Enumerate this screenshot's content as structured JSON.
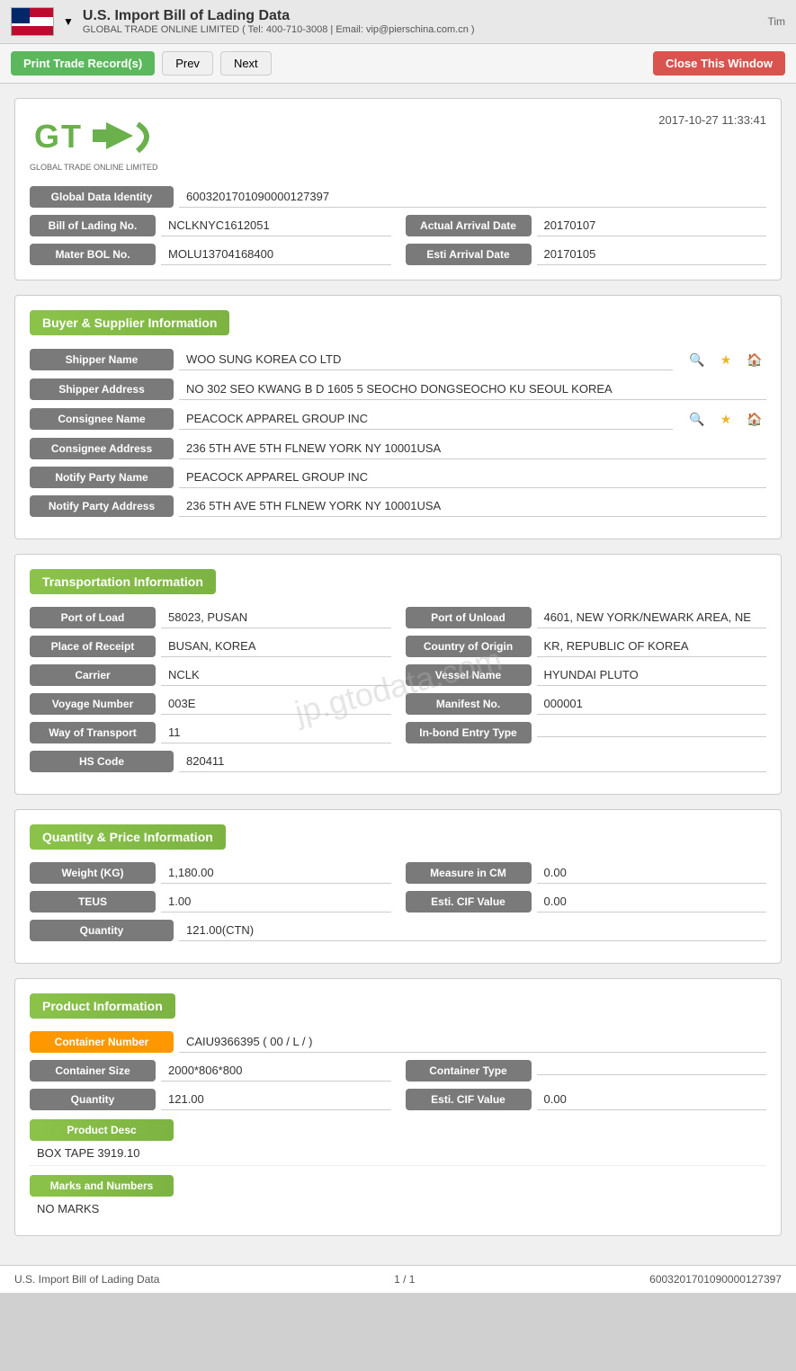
{
  "topbar": {
    "title": "U.S. Import Bill of Lading Data",
    "subtitle": "GLOBAL TRADE ONLINE LIMITED ( Tel: 400-710-3008 | Email: vip@pierschina.com.cn )",
    "right_text": "Tim",
    "dropdown_icon": "▼"
  },
  "toolbar": {
    "print_label": "Print Trade Record(s)",
    "prev_label": "Prev",
    "next_label": "Next",
    "close_label": "Close This Window"
  },
  "header_card": {
    "date": "2017-10-27 11:33:41",
    "logo_sub": "GLOBAL TRADE ONLINE LIMITED",
    "global_data_identity_label": "Global Data Identity",
    "global_data_identity_value": "6003201701090000127397",
    "bill_of_lading_label": "Bill of Lading No.",
    "bill_of_lading_value": "NCLKNYC1612051",
    "actual_arrival_label": "Actual Arrival Date",
    "actual_arrival_value": "20170107",
    "master_bol_label": "Mater BOL No.",
    "master_bol_value": "MOLU13704168400",
    "esti_arrival_label": "Esti Arrival Date",
    "esti_arrival_value": "20170105"
  },
  "buyer_supplier": {
    "section_title": "Buyer & Supplier Information",
    "shipper_name_label": "Shipper Name",
    "shipper_name_value": "WOO SUNG KOREA CO LTD",
    "shipper_address_label": "Shipper Address",
    "shipper_address_value": "NO 302 SEO KWANG B D 1605 5 SEOCHO DONGSEOCHO KU SEOUL KOREA",
    "consignee_name_label": "Consignee Name",
    "consignee_name_value": "PEACOCK APPAREL GROUP INC",
    "consignee_address_label": "Consignee Address",
    "consignee_address_value": "236 5TH AVE 5TH FLNEW YORK NY 10001USA",
    "notify_party_name_label": "Notify Party Name",
    "notify_party_name_value": "PEACOCK APPAREL GROUP INC",
    "notify_party_address_label": "Notify Party Address",
    "notify_party_address_value": "236 5TH AVE 5TH FLNEW YORK NY 10001USA"
  },
  "transportation": {
    "section_title": "Transportation Information",
    "port_of_load_label": "Port of Load",
    "port_of_load_value": "58023, PUSAN",
    "port_of_unload_label": "Port of Unload",
    "port_of_unload_value": "4601, NEW YORK/NEWARK AREA, NE",
    "place_of_receipt_label": "Place of Receipt",
    "place_of_receipt_value": "BUSAN, KOREA",
    "country_of_origin_label": "Country of Origin",
    "country_of_origin_value": "KR, REPUBLIC OF KOREA",
    "carrier_label": "Carrier",
    "carrier_value": "NCLK",
    "vessel_name_label": "Vessel Name",
    "vessel_name_value": "HYUNDAI PLUTO",
    "voyage_number_label": "Voyage Number",
    "voyage_number_value": "003E",
    "manifest_no_label": "Manifest No.",
    "manifest_no_value": "000001",
    "way_of_transport_label": "Way of Transport",
    "way_of_transport_value": "11",
    "in_bond_entry_label": "In-bond Entry Type",
    "in_bond_entry_value": "",
    "hs_code_label": "HS Code",
    "hs_code_value": "820411"
  },
  "quantity_price": {
    "section_title": "Quantity & Price Information",
    "weight_label": "Weight (KG)",
    "weight_value": "1,180.00",
    "measure_label": "Measure in CM",
    "measure_value": "0.00",
    "teus_label": "TEUS",
    "teus_value": "1.00",
    "esti_cif_label": "Esti. CIF Value",
    "esti_cif_value": "0.00",
    "quantity_label": "Quantity",
    "quantity_value": "121.00(CTN)"
  },
  "product_information": {
    "section_title": "Product Information",
    "container_number_label": "Container Number",
    "container_number_value": "CAIU9366395 ( 00 / L / )",
    "container_size_label": "Container Size",
    "container_size_value": "2000*806*800",
    "container_type_label": "Container Type",
    "container_type_value": "",
    "quantity_label": "Quantity",
    "quantity_value": "121.00",
    "esti_cif_label": "Esti. CIF Value",
    "esti_cif_value": "0.00",
    "product_desc_label": "Product Desc",
    "product_desc_value": "BOX TAPE 3919.10",
    "marks_numbers_label": "Marks and Numbers",
    "marks_numbers_value": "NO MARKS"
  },
  "footer": {
    "left": "U.S. Import Bill of Lading Data",
    "center": "1 / 1",
    "right": "6003201701090000127397"
  },
  "watermark": "jp.gtodata.com"
}
